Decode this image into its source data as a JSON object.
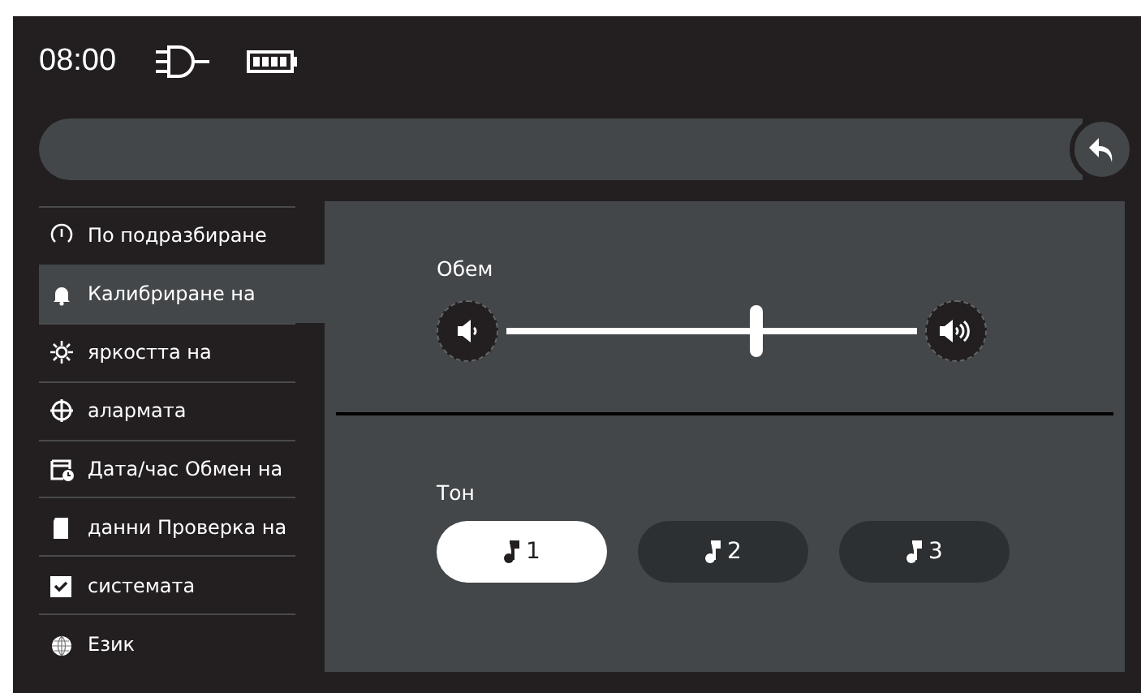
{
  "status_bar": {
    "time": "08:00"
  },
  "sidebar": {
    "items": [
      {
        "label": "По подразбиране",
        "kind": "gauge",
        "selected": false
      },
      {
        "label": "Калибриране на",
        "kind": "bell",
        "selected": true
      },
      {
        "label": "яркостта на",
        "kind": "sun",
        "selected": false
      },
      {
        "label": "алармата",
        "kind": "crosshair",
        "selected": false
      },
      {
        "label": "Дата/час Обмен на",
        "kind": "calendar",
        "selected": false
      },
      {
        "label": "данни Проверка на",
        "kind": "card",
        "selected": false
      },
      {
        "label": "системата",
        "kind": "check",
        "selected": false
      },
      {
        "label": "Език",
        "kind": "globe",
        "selected": false
      }
    ]
  },
  "volume": {
    "label": "Обем",
    "level": 0.61
  },
  "tone": {
    "label": "Тон",
    "options": [
      {
        "label": "1",
        "selected": true
      },
      {
        "label": "2",
        "selected": false
      },
      {
        "label": "3",
        "selected": false
      }
    ]
  }
}
